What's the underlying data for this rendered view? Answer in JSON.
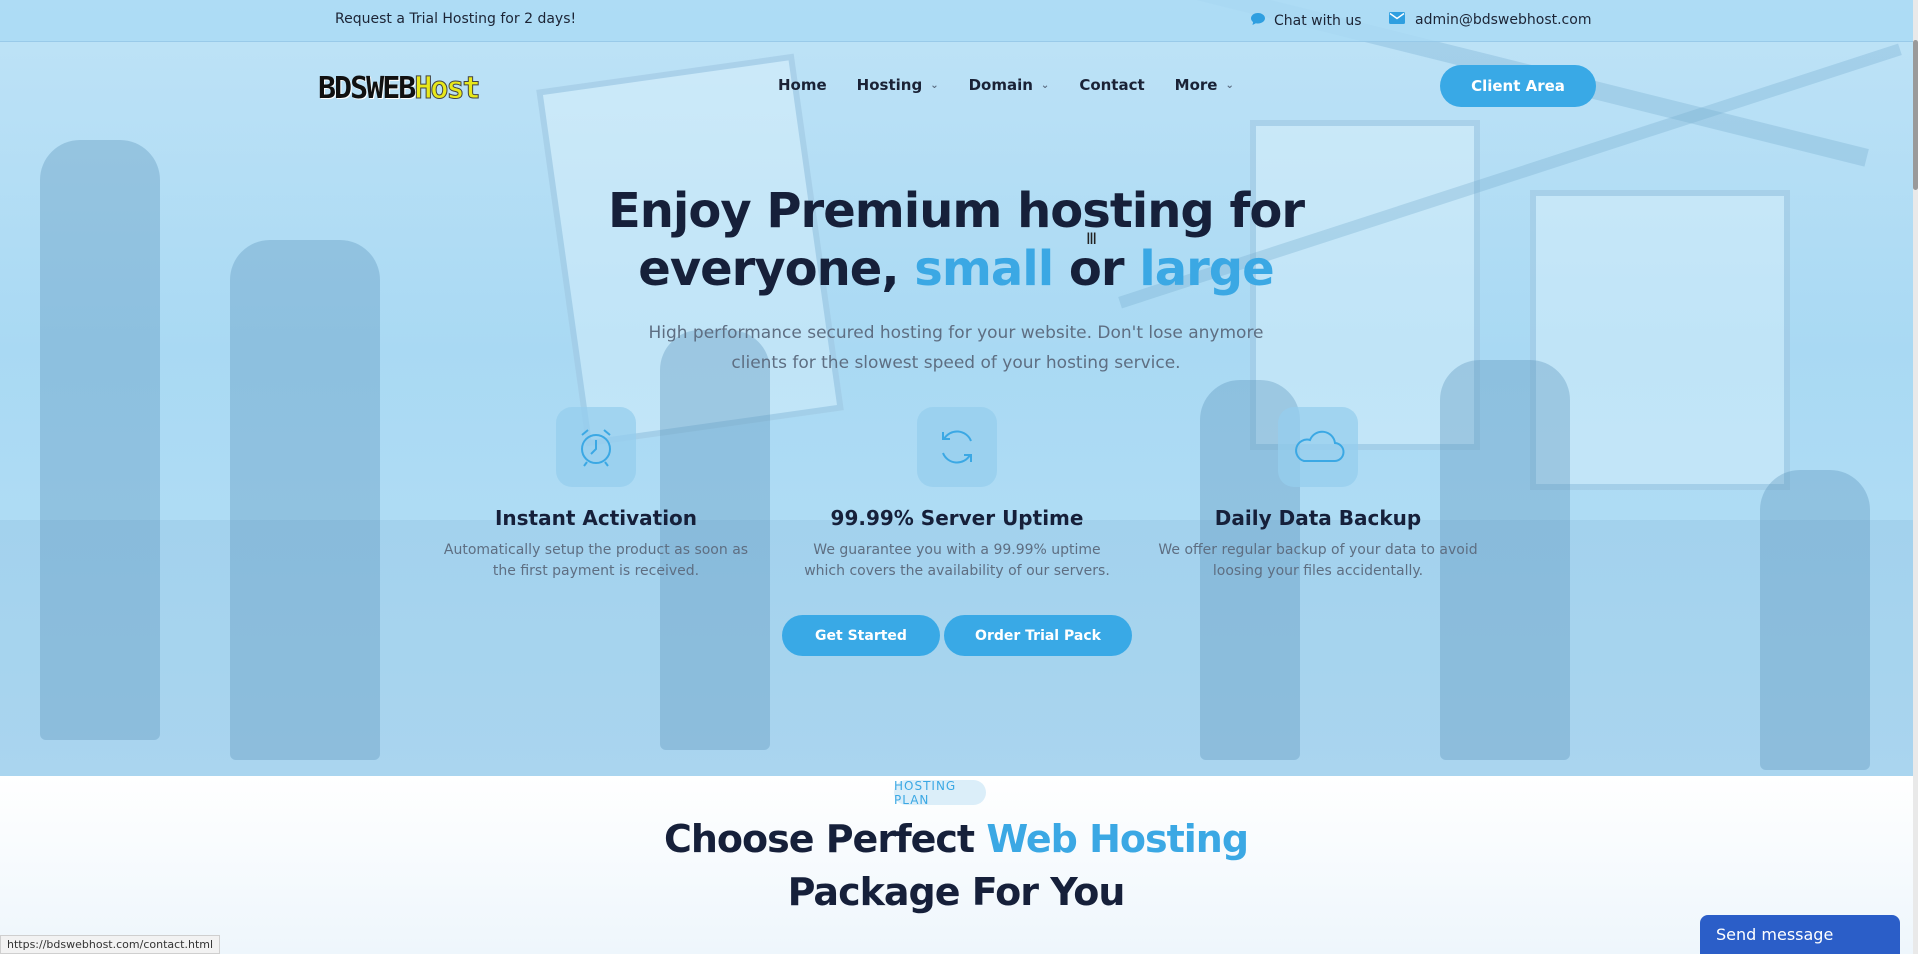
{
  "topbar": {
    "promo": "Request a Trial Hosting for 2 days!",
    "chat_label": "Chat with us",
    "email": "admin@bdswebhost.com"
  },
  "logo": {
    "part1": "BDSWEB",
    "part2": "Host"
  },
  "nav": {
    "items": [
      {
        "label": "Home",
        "dropdown": false
      },
      {
        "label": "Hosting",
        "dropdown": true
      },
      {
        "label": "Domain",
        "dropdown": true
      },
      {
        "label": "Contact",
        "dropdown": false
      },
      {
        "label": "More",
        "dropdown": true
      }
    ],
    "client_area": "Client Area"
  },
  "hero": {
    "headline_line1": "Enjoy Premium hosting for",
    "headline_word_everyone": "everyone,",
    "headline_word_small": "small",
    "headline_word_or": "or",
    "headline_word_large": "large",
    "subheading": "High performance secured hosting for your website. Don't lose anymore clients for the slowest speed of your hosting service.",
    "features": [
      {
        "icon": "alarm-clock-icon",
        "title": "Instant Activation",
        "desc": "Automatically setup the product as soon as the first payment is received."
      },
      {
        "icon": "refresh-icon",
        "title": "99.99% Server Uptime",
        "desc": "We guarantee you with a 99.99% uptime which covers the availability of our servers."
      },
      {
        "icon": "cloud-icon",
        "title": "Daily Data Backup",
        "desc": "We offer regular backup of your data to avoid loosing your files accidentally."
      }
    ],
    "get_started": "Get Started",
    "order_trial": "Order Trial Pack"
  },
  "plans": {
    "badge": "HOSTING PLAN",
    "title_part1": "Choose Perfect",
    "title_highlight": "Web Hosting",
    "title_line2": "Package For You"
  },
  "status_url": "https://bdswebhost.com/contact.html",
  "send_message": "Send message",
  "colors": {
    "accent": "#39a9e6",
    "heading": "#16203a",
    "body_text": "#5e6e82",
    "chat_widget": "#2b5ec8"
  }
}
